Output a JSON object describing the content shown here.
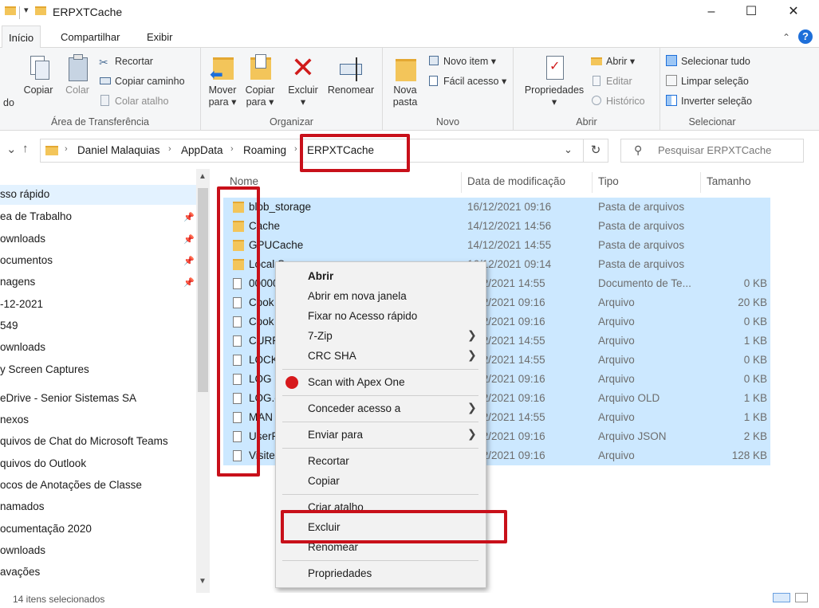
{
  "window": {
    "title": "ERPXTCache"
  },
  "tabs": [
    {
      "label": "Início"
    },
    {
      "label": "Compartilhar"
    },
    {
      "label": "Exibir"
    }
  ],
  "ribbon": {
    "clipboard": {
      "label": "Área de Transferência",
      "pin_partial": "do",
      "copy": "Copiar",
      "paste": "Colar",
      "cut": "Recortar",
      "copy_path": "Copiar caminho",
      "paste_shortcut": "Colar atalho"
    },
    "organize": {
      "label": "Organizar",
      "move_l1": "Mover",
      "move_l2": "para",
      "copy_l1": "Copiar",
      "copy_l2": "para",
      "delete": "Excluir",
      "rename": "Renomear"
    },
    "new": {
      "label": "Novo",
      "new_folder_l1": "Nova",
      "new_folder_l2": "pasta",
      "new_item": "Novo item",
      "easy_access": "Fácil acesso"
    },
    "open": {
      "label": "Abrir",
      "properties": "Propriedades",
      "open": "Abrir",
      "edit": "Editar",
      "history": "Histórico"
    },
    "select": {
      "label": "Selecionar",
      "select_all": "Selecionar tudo",
      "clear": "Limpar seleção",
      "invert": "Inverter seleção"
    }
  },
  "address": {
    "crumbs": [
      "Daniel Malaquias",
      "AppData",
      "Roaming",
      "ERPXTCache"
    ],
    "search_placeholder": "Pesquisar ERPXTCache"
  },
  "navpane": {
    "items": [
      {
        "label": "sso rápido"
      },
      {
        "label": "ea de Trabalho"
      },
      {
        "label": "ownloads"
      },
      {
        "label": "ocumentos"
      },
      {
        "label": "nagens"
      },
      {
        "label": "-12-2021"
      },
      {
        "label": "549"
      },
      {
        "label": "ownloads"
      },
      {
        "label": "y Screen Captures"
      },
      {
        "label": "eDrive - Senior Sistemas SA"
      },
      {
        "label": "nexos"
      },
      {
        "label": "quivos de Chat do Microsoft Teams"
      },
      {
        "label": "quivos do Outlook"
      },
      {
        "label": "ocos de Anotações de Classe"
      },
      {
        "label": "namados"
      },
      {
        "label": "ocumentação 2020"
      },
      {
        "label": "ownloads"
      },
      {
        "label": "avações"
      }
    ]
  },
  "columns": {
    "name": "Nome",
    "date": "Data de modificação",
    "type": "Tipo",
    "size": "Tamanho"
  },
  "files": [
    {
      "name": "blob_storage",
      "date": "16/12/2021 09:16",
      "type": "Pasta de arquivos",
      "size": "",
      "icon": "folder"
    },
    {
      "name": "Cache",
      "date": "14/12/2021 14:56",
      "type": "Pasta de arquivos",
      "size": "",
      "icon": "folder"
    },
    {
      "name": "GPUCache",
      "date": "14/12/2021 14:55",
      "type": "Pasta de arquivos",
      "size": "",
      "icon": "folder"
    },
    {
      "name": "Local S",
      "date": "16/12/2021 09:14",
      "type": "Pasta de arquivos",
      "size": "",
      "icon": "folder"
    },
    {
      "name": "00000",
      "date": "2/12/2021 14:55",
      "type": "Documento de Te...",
      "size": "0 KB",
      "icon": "file"
    },
    {
      "name": "Cook",
      "date": "2/12/2021 09:16",
      "type": "Arquivo",
      "size": "20 KB",
      "icon": "file"
    },
    {
      "name": "Cook",
      "date": "2/12/2021 09:16",
      "type": "Arquivo",
      "size": "0 KB",
      "icon": "file"
    },
    {
      "name": "CURR",
      "date": "2/12/2021 14:55",
      "type": "Arquivo",
      "size": "1 KB",
      "icon": "file"
    },
    {
      "name": "LOCK",
      "date": "2/12/2021 14:55",
      "type": "Arquivo",
      "size": "0 KB",
      "icon": "file"
    },
    {
      "name": "LOG",
      "date": "2/12/2021 09:16",
      "type": "Arquivo",
      "size": "0 KB",
      "icon": "file"
    },
    {
      "name": "LOG.o",
      "date": "2/12/2021 09:16",
      "type": "Arquivo OLD",
      "size": "1 KB",
      "icon": "file"
    },
    {
      "name": "MAN",
      "date": "2/12/2021 14:55",
      "type": "Arquivo",
      "size": "1 KB",
      "icon": "file"
    },
    {
      "name": "UserP",
      "date": "2/12/2021 09:16",
      "type": "Arquivo JSON",
      "size": "2 KB",
      "icon": "file"
    },
    {
      "name": "Visite",
      "date": "2/12/2021 09:16",
      "type": "Arquivo",
      "size": "128 KB",
      "icon": "file"
    }
  ],
  "context_menu": {
    "open": "Abrir",
    "open_new_window": "Abrir em nova janela",
    "pin_quick": "Fixar no Acesso rápido",
    "zip": "7-Zip",
    "crc": "CRC SHA",
    "apex": "Scan with Apex One",
    "grant": "Conceder acesso a",
    "send_to": "Enviar para",
    "cut": "Recortar",
    "copy": "Copiar",
    "shortcut": "Criar atalho",
    "delete": "Excluir",
    "rename": "Renomear",
    "properties": "Propriedades"
  },
  "status": {
    "text": "14 itens selecionados"
  },
  "colors": {
    "selection": "#cce8ff",
    "annotation": "#c8101a",
    "accent": "#1e6fd9"
  }
}
